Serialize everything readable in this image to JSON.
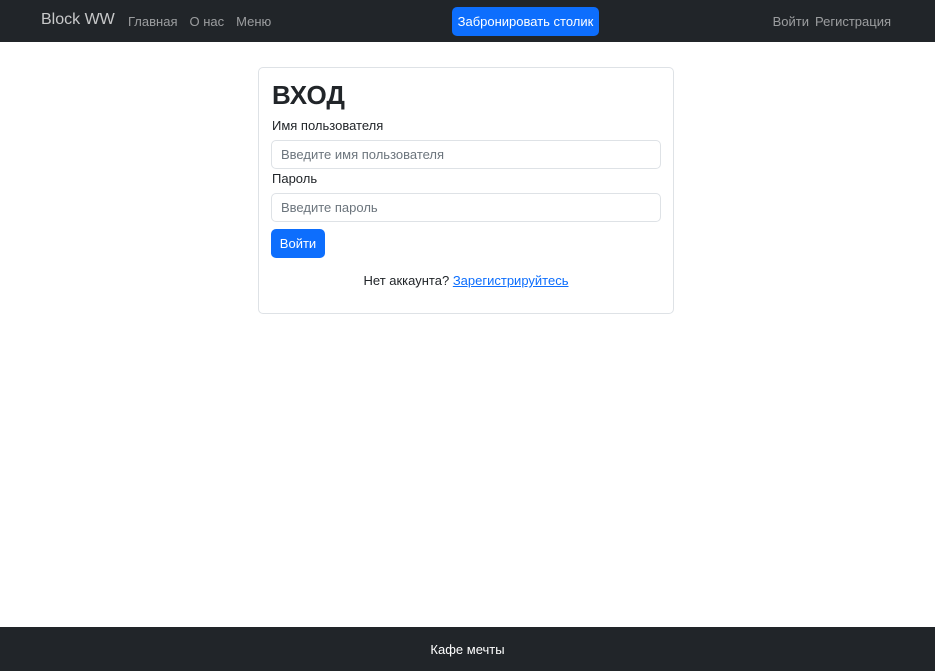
{
  "navbar": {
    "brand": "Block WW",
    "links": [
      "Главная",
      "О нас",
      "Меню"
    ],
    "book_button": "Забронировать столик",
    "auth_links": [
      "Войти",
      "Регистрация"
    ],
    "colors": {
      "background": "#212529",
      "accent": "#0d6efd"
    }
  },
  "login": {
    "title": "ВХОД",
    "username_label": "Имя пользователя",
    "username_placeholder": "Введите имя пользователя",
    "username_value": "",
    "password_label": "Пароль",
    "password_placeholder": "Введите пароль",
    "password_value": "",
    "submit_label": "Войти",
    "no_account_text": "Нет аккаунта?",
    "register_link": "Зарегистрируйтесь"
  },
  "footer": {
    "text": "Кафе мечты"
  }
}
